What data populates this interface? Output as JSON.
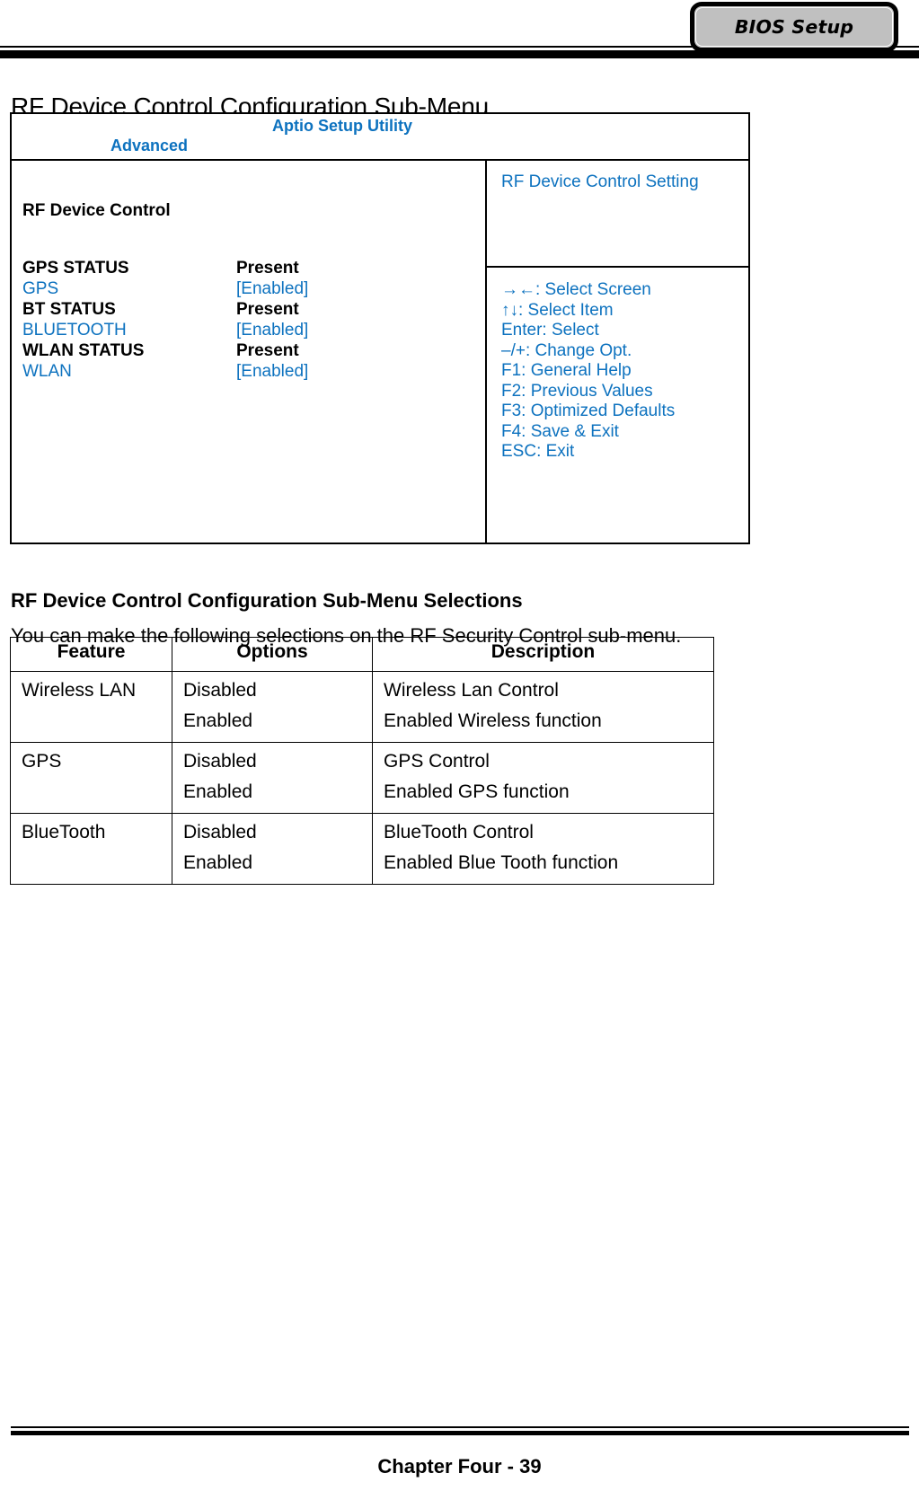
{
  "header": {
    "badge_label": "BIOS Setup"
  },
  "section_title": "RF Device Control Configuration Sub-Menu",
  "bios_panel": {
    "utility_title": "Aptio Setup Utility",
    "active_tab": "Advanced",
    "group_label": "RF Device Control",
    "items": [
      {
        "name": "GPS STATUS",
        "value": "Present",
        "kind": "status"
      },
      {
        "name": "GPS",
        "value": "[Enabled]",
        "kind": "option"
      },
      {
        "name": "BT STATUS",
        "value": "Present",
        "kind": "status"
      },
      {
        "name": "BLUETOOTH",
        "value": "[Enabled]",
        "kind": "option"
      },
      {
        "name": "WLAN STATUS",
        "value": "Present",
        "kind": "status"
      },
      {
        "name": "WLAN",
        "value": "[Enabled]",
        "kind": "option"
      }
    ],
    "help_title": "RF Device Control Setting",
    "key_legend": [
      "→←: Select Screen",
      "↑↓: Select Item",
      "Enter: Select",
      "–/+: Change Opt.",
      "F1: General Help",
      "F2: Previous Values",
      "F3: Optimized Defaults",
      "F4: Save & Exit",
      "ESC: Exit"
    ],
    "accent_color": "#0d72bf"
  },
  "selections": {
    "heading": "RF Device Control Configuration Sub-Menu Selections",
    "intro": "You can make the following selections on the RF Security Control sub-menu.",
    "columns": [
      "Feature",
      "Options",
      "Description"
    ],
    "rows": [
      {
        "feature": "Wireless LAN",
        "options": [
          "Disabled",
          "Enabled"
        ],
        "description": [
          "Wireless Lan Control",
          "Enabled Wireless function"
        ]
      },
      {
        "feature": "GPS",
        "options": [
          "Disabled",
          "Enabled"
        ],
        "description": [
          "GPS Control",
          "Enabled GPS function"
        ]
      },
      {
        "feature": "BlueTooth",
        "options": [
          "Disabled",
          "Enabled"
        ],
        "description": [
          "BlueTooth Control",
          "Enabled Blue Tooth function"
        ]
      }
    ]
  },
  "footer": {
    "page_label": "Chapter Four - 39"
  }
}
